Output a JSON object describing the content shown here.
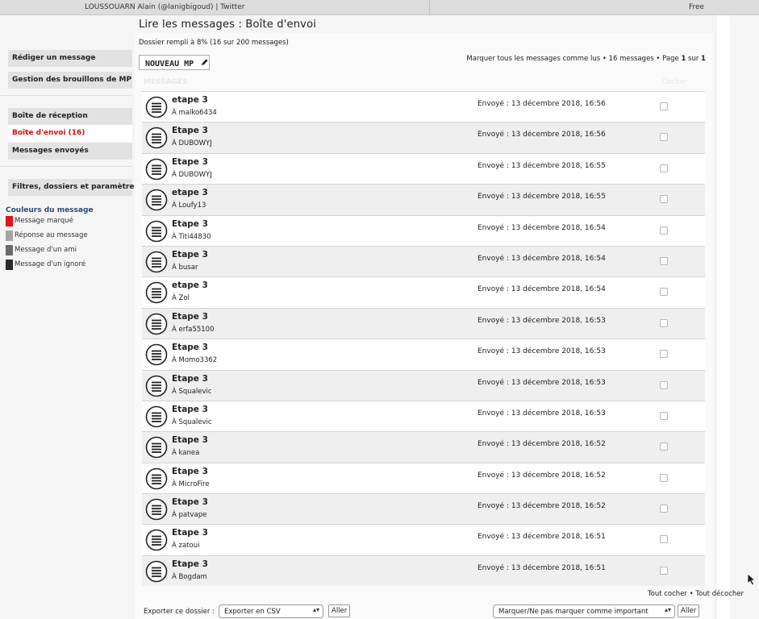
{
  "topbar": {
    "title": "LOUSSOUARN Alain (@lanigbigoud) | Twitter",
    "right": "Free"
  },
  "sidebar": {
    "compose": "Rédiger un message",
    "drafts": "Gestion des brouillons de MP",
    "inbox": "Boîte de réception",
    "outbox": "Boîte d'envoi (16)",
    "sent": "Messages envoyés",
    "filters": "Filtres, dossiers et paramètres",
    "legend_title": "Couleurs du message",
    "legend": [
      {
        "label": "Message marqué",
        "color": "#e3141a"
      },
      {
        "label": "Réponse au message",
        "color": "#a5a5a5"
      },
      {
        "label": "Message d'un ami",
        "color": "#6b6b6b"
      },
      {
        "label": "Message d'un ignoré",
        "color": "#2b2b2b"
      }
    ]
  },
  "main": {
    "title": "Lire les messages : Boîte d'envoi",
    "fill_info": "Dossier rempli à 8% (16 sur 200 messages)",
    "new_mp": "NOUVEAU MP",
    "mark_all": "Marquer tous les messages comme lus • 16 messages • Page ",
    "page_current": "1",
    "page_sep": " sur ",
    "page_total": "1",
    "header_message": "MESSAGES",
    "header_select": "Cocher"
  },
  "messages": [
    {
      "subject": "etape 3",
      "recipient": "À malko6434",
      "date": "Envoyé : 13 décembre 2018, 16:56"
    },
    {
      "subject": "Etape 3",
      "recipient": "À DUBOWYJ",
      "date": "Envoyé : 13 décembre 2018, 16:56"
    },
    {
      "subject": "Etape 3",
      "recipient": "À DUBOWYJ",
      "date": "Envoyé : 13 décembre 2018, 16:55"
    },
    {
      "subject": "etape 3",
      "recipient": "À Loufy13",
      "date": "Envoyé : 13 décembre 2018, 16:55"
    },
    {
      "subject": "Etape 3",
      "recipient": "À Titi44830",
      "date": "Envoyé : 13 décembre 2018, 16:54"
    },
    {
      "subject": "Etape 3",
      "recipient": "À busar",
      "date": "Envoyé : 13 décembre 2018, 16:54"
    },
    {
      "subject": "etape 3",
      "recipient": "À Zol",
      "date": "Envoyé : 13 décembre 2018, 16:54"
    },
    {
      "subject": "Etape 3",
      "recipient": "À erfa55100",
      "date": "Envoyé : 13 décembre 2018, 16:53"
    },
    {
      "subject": "Etape 3",
      "recipient": "À Momo3362",
      "date": "Envoyé : 13 décembre 2018, 16:53"
    },
    {
      "subject": "Etape 3",
      "recipient": "À Squalevic",
      "date": "Envoyé : 13 décembre 2018, 16:53"
    },
    {
      "subject": "Etape 3",
      "recipient": "À Squalevic",
      "date": "Envoyé : 13 décembre 2018, 16:53"
    },
    {
      "subject": "Etape 3",
      "recipient": "À kanea",
      "date": "Envoyé : 13 décembre 2018, 16:52"
    },
    {
      "subject": "Etape 3",
      "recipient": "À MicroFire",
      "date": "Envoyé : 13 décembre 2018, 16:52"
    },
    {
      "subject": "Etape 3",
      "recipient": "À patvape",
      "date": "Envoyé : 13 décembre 2018, 16:52"
    },
    {
      "subject": "Etape 3",
      "recipient": "À zatoui",
      "date": "Envoyé : 13 décembre 2018, 16:51"
    },
    {
      "subject": "Etape 3",
      "recipient": "À Bogdam",
      "date": "Envoyé : 13 décembre 2018, 16:51"
    }
  ],
  "bottom": {
    "export_label": "Exporter ce dossier :",
    "export_select": "Exporter en CSV",
    "go": "Aller",
    "mark_select": "Marquer/Ne pas marquer comme important",
    "go2": "Aller",
    "check_all": "Tout cocher",
    "link_sep": " • ",
    "uncheck_all": "Tout décocher"
  }
}
